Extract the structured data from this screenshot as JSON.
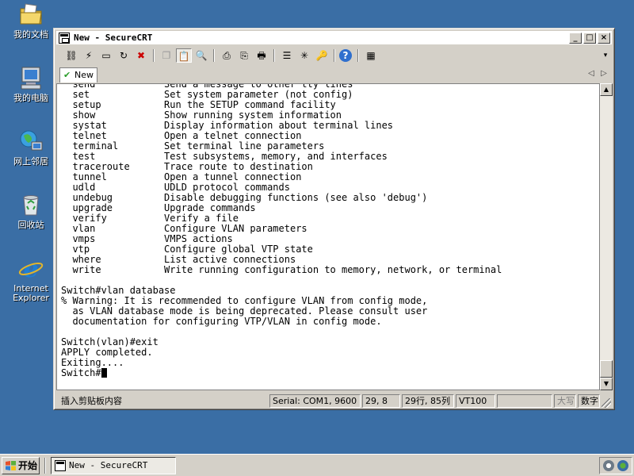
{
  "desktop": {
    "icons": [
      {
        "label": "我的文档",
        "icon": "my-documents-icon"
      },
      {
        "label": "我的电脑",
        "icon": "my-computer-icon"
      },
      {
        "label": "网上邻居",
        "icon": "network-places-icon"
      },
      {
        "label": "回收站",
        "icon": "recycle-bin-icon"
      },
      {
        "label": "Internet Explorer",
        "icon": "internet-explorer-icon"
      }
    ]
  },
  "window": {
    "title": "New - SecureCRT",
    "minimize": "_",
    "maximize": "□",
    "close": "×"
  },
  "toolbar": {
    "buttons": [
      {
        "icon": "connect-icon",
        "glyph": "⛓"
      },
      {
        "icon": "quick-connect-icon",
        "glyph": "⚡"
      },
      {
        "icon": "connect-tab-icon",
        "glyph": "▭"
      },
      {
        "icon": "reconnect-icon",
        "glyph": "↻"
      },
      {
        "icon": "disconnect-icon",
        "glyph": "✖"
      },
      {
        "icon": "copy-icon",
        "glyph": "❐"
      },
      {
        "icon": "paste-icon",
        "glyph": "📋"
      },
      {
        "icon": "find-icon",
        "glyph": "🔍"
      },
      {
        "icon": "print-icon",
        "glyph": "⎙"
      },
      {
        "icon": "print-selection-icon",
        "glyph": "⎘"
      },
      {
        "icon": "print-setup-icon",
        "glyph": "🖶"
      },
      {
        "icon": "session-options-icon",
        "glyph": "☰"
      },
      {
        "icon": "global-options-icon",
        "glyph": "✳"
      },
      {
        "icon": "keymap-icon",
        "glyph": "🔑"
      },
      {
        "icon": "help-icon",
        "glyph": "?"
      },
      {
        "icon": "sftp-icon",
        "glyph": "▦"
      }
    ]
  },
  "tabs": [
    {
      "label": "New",
      "status_icon": "connected-check-icon"
    }
  ],
  "tab_nav": {
    "prev": "◁",
    "next": "▷"
  },
  "terminal": {
    "lines": [
      "  send            Send a message to other tty lines",
      "  set             Set system parameter (not config)",
      "  setup           Run the SETUP command facility",
      "  show            Show running system information",
      "  systat          Display information about terminal lines",
      "  telnet          Open a telnet connection",
      "  terminal        Set terminal line parameters",
      "  test            Test subsystems, memory, and interfaces",
      "  traceroute      Trace route to destination",
      "  tunnel          Open a tunnel connection",
      "  udld            UDLD protocol commands",
      "  undebug         Disable debugging functions (see also 'debug')",
      "  upgrade         Upgrade commands",
      "  verify          Verify a file",
      "  vlan            Configure VLAN parameters",
      "  vmps            VMPS actions",
      "  vtp             Configure global VTP state",
      "  where           List active connections",
      "  write           Write running configuration to memory, network, or terminal",
      "",
      "Switch#vlan database",
      "% Warning: It is recommended to configure VLAN from config mode,",
      "  as VLAN database mode is being deprecated. Please consult user",
      "  documentation for configuring VTP/VLAN in config mode.",
      "",
      "Switch(vlan)#exit",
      "APPLY completed.",
      "Exiting....",
      "Switch#"
    ]
  },
  "scrollbar": {
    "up": "▲",
    "down": "▼"
  },
  "statusbar": {
    "message": "插入剪贴板内容",
    "connection": "Serial: COM1, 9600",
    "cursor_pos": "29,  8",
    "rows_cols": "29行, 85列",
    "terminal_type": "VT100",
    "caps": "大写",
    "num": "数字"
  },
  "taskbar": {
    "start_label": "开始",
    "tasks": [
      {
        "label": "New - SecureCRT"
      }
    ]
  }
}
